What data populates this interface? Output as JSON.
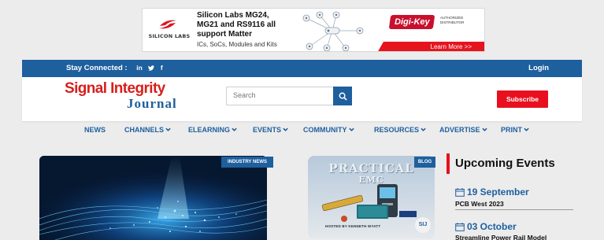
{
  "ad": {
    "brand": "SILICON LABS",
    "headline": "Silicon Labs MG24, MG21 and RS9116 all support Matter",
    "subline": "ICs, SoCs, Modules and Kits",
    "distributor_logo": "Digi-Key",
    "distributor_tag": "AUTHORIZED DISTRIBUTOR",
    "cta": "Learn More >>"
  },
  "topbar": {
    "stay_connected": "Stay Connected :",
    "social": [
      "in",
      "twitter-icon",
      "facebook-icon"
    ],
    "social_glyphs": [
      "in",
      "✔",
      "f"
    ],
    "login": "Login"
  },
  "header": {
    "logo_line1": "Signal Integrity",
    "logo_line2": "Journal",
    "search_placeholder": "Search",
    "subscribe": "Subscribe"
  },
  "nav": [
    {
      "label": "NEWS",
      "dropdown": false
    },
    {
      "label": "CHANNELS",
      "dropdown": true
    },
    {
      "label": "ELEARNING",
      "dropdown": true
    },
    {
      "label": "EVENTS",
      "dropdown": true
    },
    {
      "label": "COMMUNITY",
      "dropdown": true
    },
    {
      "label": "RESOURCES",
      "dropdown": true
    },
    {
      "label": "ADVERTISE",
      "dropdown": true
    },
    {
      "label": "PRINT",
      "dropdown": true
    }
  ],
  "content": {
    "hero_badge": "INDUSTRY NEWS",
    "blog_badge": "BLOG",
    "blog_title1": "PRACTICAL",
    "blog_title2": "EMC",
    "blog_host": "HOSTED BY KENNETH WYATT",
    "blog_brand": "SIJ"
  },
  "events": {
    "title": "Upcoming Events",
    "items": [
      {
        "date": "19 September",
        "name": "PCB West 2023"
      },
      {
        "date": "03 October",
        "name": "Streamline Power Rail Model"
      }
    ]
  },
  "colors": {
    "brand_blue": "#1e5f9e",
    "accent_red": "#e8101e"
  }
}
